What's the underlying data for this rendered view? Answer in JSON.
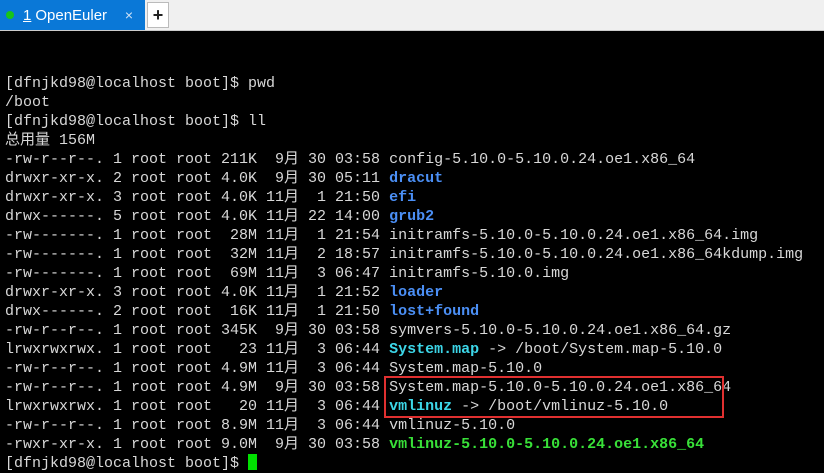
{
  "tab": {
    "number": "1",
    "title": "OpenEuler",
    "close": "×",
    "new_tab": "+"
  },
  "prompt": "[dfnjkd98@localhost boot]$ ",
  "lines": [
    {
      "pre": "[dfnjkd98@localhost boot]$ pwd",
      "name": "",
      "type": "text"
    },
    {
      "pre": "/boot",
      "name": "",
      "type": "text"
    },
    {
      "pre": "[dfnjkd98@localhost boot]$ ll",
      "name": "",
      "type": "text"
    },
    {
      "pre": "总用量 156M",
      "name": "",
      "type": "text"
    },
    {
      "pre": "-rw-r--r--. 1 root root 211K  9月 30 03:58 ",
      "name": "config-5.10.0-5.10.0.24.oe1.x86_64",
      "type": "file"
    },
    {
      "pre": "drwxr-xr-x. 2 root root 4.0K  9月 30 05:11 ",
      "name": "dracut",
      "type": "dir"
    },
    {
      "pre": "drwxr-xr-x. 3 root root 4.0K 11月  1 21:50 ",
      "name": "efi",
      "type": "dir"
    },
    {
      "pre": "drwx------. 5 root root 4.0K 11月 22 14:00 ",
      "name": "grub2",
      "type": "dir"
    },
    {
      "pre": "-rw-------. 1 root root  28M 11月  1 21:54 ",
      "name": "initramfs-5.10.0-5.10.0.24.oe1.x86_64.img",
      "type": "file"
    },
    {
      "pre": "-rw-------. 1 root root  32M 11月  2 18:57 ",
      "name": "initramfs-5.10.0-5.10.0.24.oe1.x86_64kdump.img",
      "type": "file"
    },
    {
      "pre": "-rw-------. 1 root root  69M 11月  3 06:47 ",
      "name": "initramfs-5.10.0.img",
      "type": "file"
    },
    {
      "pre": "drwxr-xr-x. 3 root root 4.0K 11月  1 21:52 ",
      "name": "loader",
      "type": "dir"
    },
    {
      "pre": "drwx------. 2 root root  16K 11月  1 21:50 ",
      "name": "lost+found",
      "type": "dir"
    },
    {
      "pre": "-rw-r--r--. 1 root root 345K  9月 30 03:58 ",
      "name": "symvers-5.10.0-5.10.0.24.oe1.x86_64.gz",
      "type": "file"
    },
    {
      "pre": "lrwxrwxrwx. 1 root root   23 11月  3 06:44 ",
      "name": "System.map",
      "type": "lnk",
      "target": " -> /boot/System.map-5.10.0"
    },
    {
      "pre": "-rw-r--r--. 1 root root 4.9M 11月  3 06:44 ",
      "name": "System.map-5.10.0",
      "type": "file"
    },
    {
      "pre": "-rw-r--r--. 1 root root 4.9M  9月 30 03:58 ",
      "name": "System.map-5.10.0-5.10.0.24.oe1.x86_64",
      "type": "file"
    },
    {
      "pre": "lrwxrwxrwx. 1 root root   20 11月  3 06:44 ",
      "name": "vmlinuz",
      "type": "lnk",
      "target": " -> /boot/vmlinuz-5.10.0"
    },
    {
      "pre": "-rw-r--r--. 1 root root 8.9M 11月  3 06:44 ",
      "name": "vmlinuz-5.10.0",
      "type": "file"
    },
    {
      "pre": "-rwxr-xr-x. 1 root root 9.0M  9月 30 03:58 ",
      "name": "vmlinuz-5.10.0-5.10.0.24.oe1.x86_64",
      "type": "exe"
    }
  ]
}
